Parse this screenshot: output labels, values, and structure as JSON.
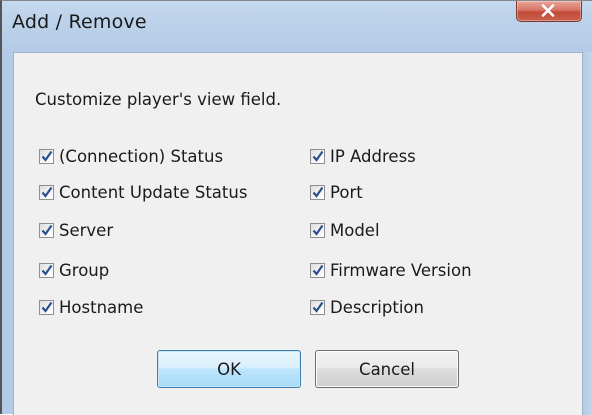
{
  "window": {
    "title": "Add / Remove"
  },
  "dialog": {
    "instruction": "Customize player's view field.",
    "left_column": [
      {
        "label": "(Connection) Status",
        "checked": true
      },
      {
        "label": "Content Update Status",
        "checked": true
      },
      {
        "label": "Server",
        "checked": true
      },
      {
        "label": "Group",
        "checked": true
      },
      {
        "label": "Hostname",
        "checked": true
      }
    ],
    "right_column": [
      {
        "label": "IP Address",
        "checked": true
      },
      {
        "label": "Port",
        "checked": true
      },
      {
        "label": "Model",
        "checked": true
      },
      {
        "label": "Firmware Version",
        "checked": true
      },
      {
        "label": "Description",
        "checked": true
      }
    ],
    "buttons": {
      "ok_label": "OK",
      "cancel_label": "Cancel"
    }
  },
  "icons": {
    "close": "close-icon",
    "check": "checkmark-icon"
  },
  "colors": {
    "title_bar": "#bcd2ea",
    "close_button": "#c9614f",
    "client_background": "#f0f0f0",
    "checkmark": "#2a4f8f",
    "ok_button_border": "#3c7fb1"
  }
}
